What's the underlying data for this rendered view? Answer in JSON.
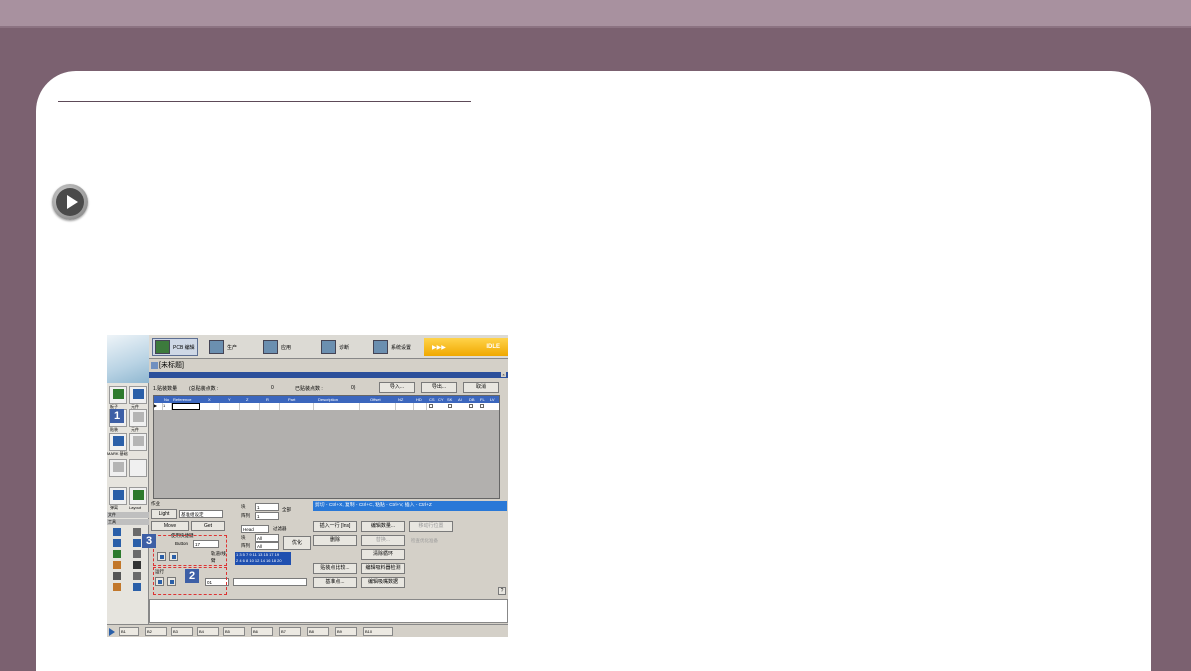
{
  "app": {
    "tabs": [
      {
        "label": "PCB 编辑",
        "active": true
      },
      {
        "label": "生产"
      },
      {
        "label": "应用"
      },
      {
        "label": "诊断"
      },
      {
        "label": "系统设置"
      }
    ],
    "status": "IDLE",
    "status_arrows": "▶▶▶",
    "doc_title": "[未标题]",
    "left_panel": {
      "board_label": "板子",
      "component_label": "元件",
      "mark_label": "贴装",
      "nozzle_label": "元件",
      "fiducial_label": "MARK 基础",
      "eject_label": "弹离",
      "layout_label": "Layout",
      "file_label": "文件",
      "tool_label": "工具"
    },
    "info": {
      "mount_count": "1.贴装数量",
      "total_label": "(总贴装点数 :",
      "total_value": "0",
      "done_label": "已贴装点数 :",
      "done_value": "0)",
      "import_button": "导入...",
      "export_button": "导出...",
      "cancel_button": "取消"
    },
    "grid_headers": [
      "No",
      "Reference",
      "X",
      "Y",
      "Z",
      "R",
      "Part",
      "Description",
      "Offset",
      "NZ",
      "HD",
      "CS",
      "CY",
      "SK",
      "AI",
      "DB",
      "FL",
      "LV"
    ],
    "grid_row": {
      "indicator": "▶",
      "no": "1"
    },
    "bottom": {
      "work_label": "作业",
      "light_label": "Light",
      "light_value": "基准组设定",
      "move_label": "Move",
      "get_label": "Get",
      "use_shortcut": "使用快捷键",
      "button_label": "Button",
      "button_value": "17",
      "block_label": "块",
      "block_value": "1",
      "array_label": "阵列",
      "array_value": "1",
      "all_label": "全部",
      "head_value": "Head",
      "filter_label": "过滤器",
      "block2_label": "块",
      "all_value": "All",
      "array2_label": "阵列",
      "all_value2": "All",
      "optimize_label": "优化",
      "path_label": "轨道/线",
      "arm_label": "臂",
      "numbers_row1": "1 3 5 7 9 11 13 15 17 19",
      "numbers_row2": "2 4 6 8 10 12 14 16 18 20",
      "speed_label": "运行",
      "speed_value": "01",
      "hint": "剪切 - Ctrl+X, 复制 - Ctrl+C, 粘贴 - Ctrl+V, 插入 - Ctrl+Z",
      "insert_button": "插入一行 [Ins]",
      "delete_button": "删除",
      "bulk_button": "编辑数量...",
      "replace_button": "替换...",
      "move_row_button": "移动行位置",
      "refresh_button": "刷新(确认)",
      "clear_button": "清除循环",
      "check_box_label": "检查优化准备",
      "ref_compare_button": "贴装点比较...",
      "edit_path_button": "编辑吸料器检测",
      "base_point_button": "基准点...",
      "edit_feed_button": "编辑吸嘴数据"
    },
    "badges": [
      "1",
      "2",
      "3"
    ],
    "status_items": [
      "B1",
      "B2",
      "B3",
      "B4",
      "B5",
      "B6",
      "B7",
      "B8",
      "B9",
      "B10"
    ]
  }
}
